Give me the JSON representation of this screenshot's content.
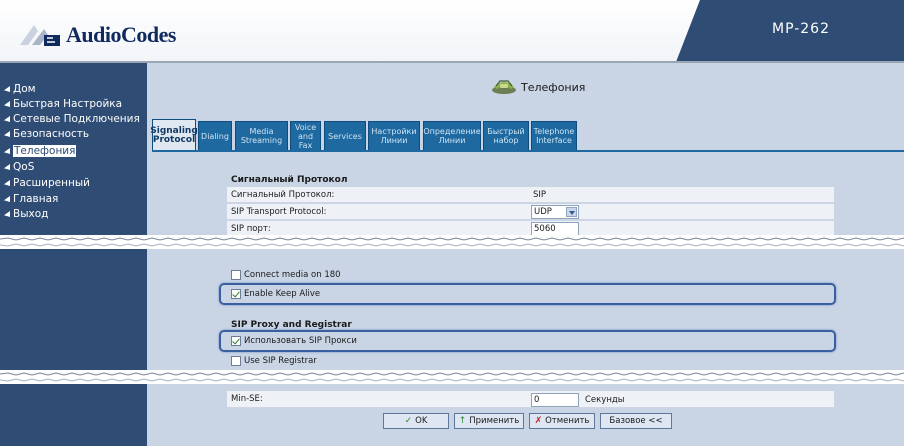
{
  "header": {
    "logo_text": "AudioCodes",
    "model": "MP-262"
  },
  "sidebar": {
    "items": [
      {
        "label": "Дом"
      },
      {
        "label": "Быстрая Настройка"
      },
      {
        "label": "Сетевые Подключения"
      },
      {
        "label": "Безопасность"
      },
      {
        "label": "Телефония"
      },
      {
        "label": "QoS"
      },
      {
        "label": "Расширенный"
      },
      {
        "label": "Главная"
      },
      {
        "label": "Выход"
      }
    ],
    "active_index": 4
  },
  "page": {
    "title": "Телефония"
  },
  "tabs": [
    {
      "label": "Signaling Protocol"
    },
    {
      "label": "Dialing"
    },
    {
      "label": "Media Streaming"
    },
    {
      "label": "Voice and Fax"
    },
    {
      "label": "Services"
    },
    {
      "label": "Настройки Линии"
    },
    {
      "label": "Определение Линии"
    },
    {
      "label": "Быстрый набор"
    },
    {
      "label": "Telephone Interface"
    }
  ],
  "section_signaling": {
    "title": "Сигнальный Протокол",
    "rows": [
      {
        "label": "Сигнальный Протокол:",
        "value": "SIP"
      },
      {
        "label": "SIP Transport Protocol:",
        "value": "UDP"
      },
      {
        "label": "SIP порт:",
        "value": "5060"
      }
    ]
  },
  "checkboxes": {
    "connect_media": {
      "label": "Connect media on 180",
      "checked": false
    },
    "keep_alive": {
      "label": "Enable Keep Alive",
      "checked": true
    }
  },
  "section_proxy": {
    "title": "SIP Proxy and Registrar",
    "use_proxy": {
      "label": "Использовать SIP Прокси",
      "checked": true
    },
    "use_registrar": {
      "label": "Use SIP Registrar",
      "checked": false
    }
  },
  "min_se": {
    "label": "Min-SE:",
    "value": "0",
    "unit": "Секунды"
  },
  "buttons": {
    "ok": "OK",
    "apply": "Применить",
    "cancel": "Отменить",
    "basic": "Базовое <<"
  },
  "colors": {
    "sidebar_bg": "#2f4c74",
    "content_bg": "#c9d5e5",
    "tab_bg": "#1e6aa0",
    "highlight": "#3a5f9e"
  }
}
